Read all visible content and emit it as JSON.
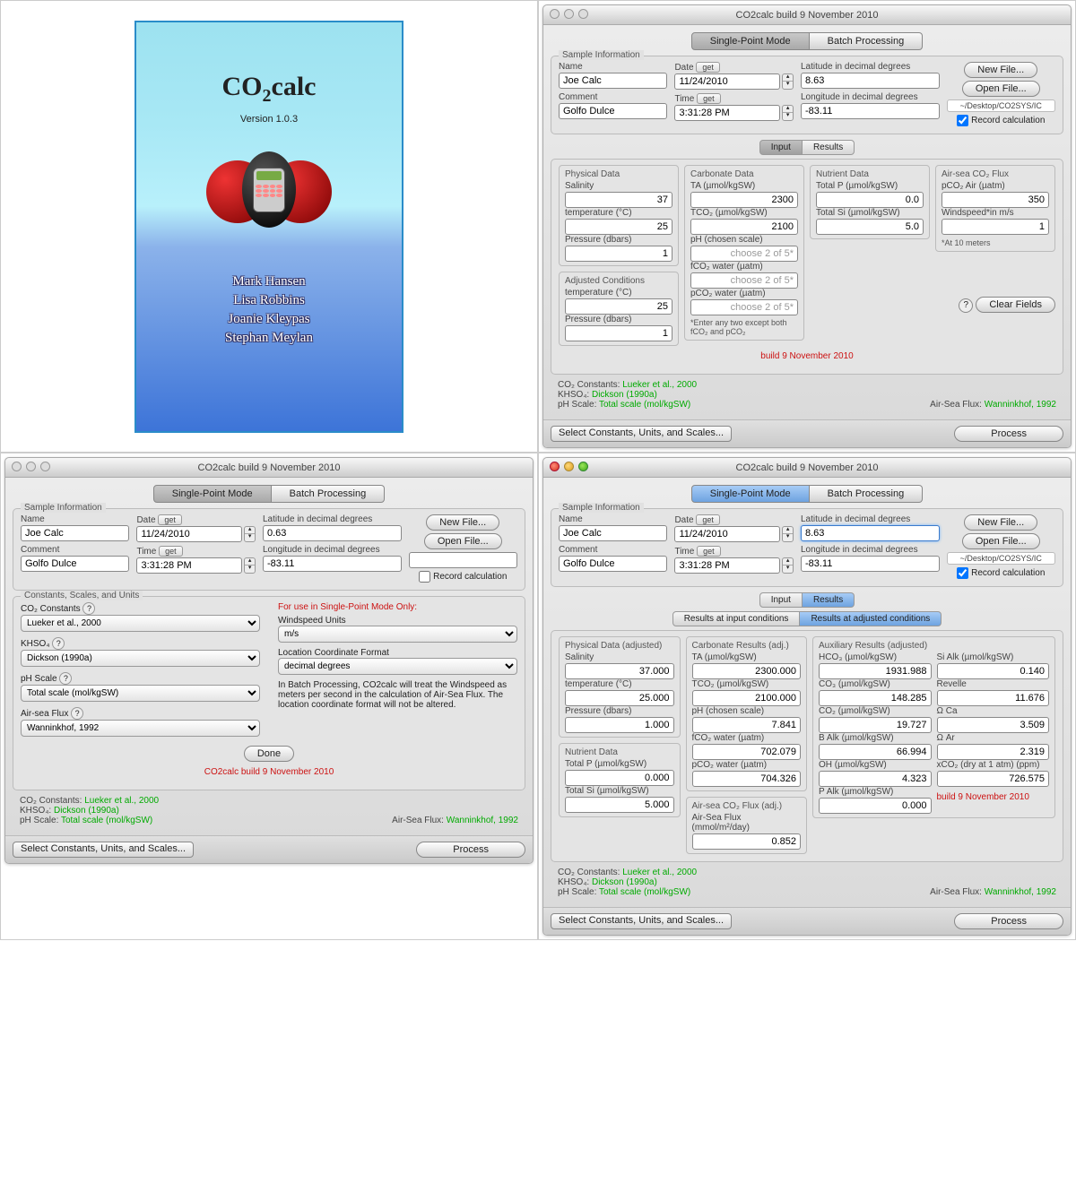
{
  "app": {
    "title": "CO2calc build 9 November 2010",
    "build_note": "build 9 November 2010",
    "build_note2": "CO2calc build 9 November 2010"
  },
  "splash": {
    "name": "CO",
    "sub": "2",
    "suffix": "calc",
    "version": "Version 1.0.3",
    "authors": [
      "Mark Hansen",
      "Lisa Robbins",
      "Joanie Kleypas",
      "Stephan Meylan"
    ]
  },
  "tabs": {
    "single": "Single-Point Mode",
    "batch": "Batch Processing",
    "input": "Input",
    "results": "Results",
    "res_input": "Results at input conditions",
    "res_adj": "Results at adjusted conditions"
  },
  "labels": {
    "sample": "Sample Information",
    "name": "Name",
    "date": "Date",
    "time": "Time",
    "comment": "Comment",
    "lat": "Latitude in decimal degrees",
    "lon": "Longitude in decimal degrees",
    "get": "get",
    "newfile": "New File...",
    "openfile": "Open File...",
    "record": "Record calculation",
    "physical": "Physical Data",
    "carbonate": "Carbonate Data",
    "nutrient": "Nutrient Data",
    "flux": "Air-sea CO₂ Flux",
    "salinity": "Salinity",
    "temp": "temperature (°C)",
    "press": "Pressure (dbars)",
    "adjusted": "Adjusted Conditions",
    "ta": "TA (µmol/kgSW)",
    "tco2": "TCO₂ (µmol/kgSW)",
    "ph": "pH (chosen scale)",
    "fco2": "fCO₂ water (µatm)",
    "pco2": "pCO₂ water (µatm)",
    "choose": "choose 2 of 5*",
    "hint": "*Enter any two except both fCO₂ and pCO₂",
    "totalp": "Total P (µmol/kgSW)",
    "totalsi": "Total Si (µmol/kgSW)",
    "pco2air": "pCO₂ Air (µatm)",
    "windspeed": "Windspeed*in m/s",
    "at10": "*At 10 meters",
    "clear": "Clear Fields",
    "select": "Select Constants, Units, and Scales...",
    "process": "Process",
    "done": "Done",
    "co2const": "CO₂ Constants:",
    "khso4": "KHSO₄:",
    "phscale": "pH Scale:",
    "airsea": "Air-Sea Flux:",
    "constants_group": "Constants, Scales, and Units",
    "co2const_l": "CO₂ Constants",
    "khso4_l": "KHSO₄",
    "phscale_l": "pH Scale",
    "airseaflux_l": "Air-sea Flux",
    "sp_note": "For use in Single-Point Mode Only:",
    "ws_units": "Windspeed Units",
    "loc_fmt": "Location Coordinate Format",
    "batch_note": "In Batch Processing, CO2calc will treat the Windspeed as meters per second in the calculation of Air-Sea Flux. The location coordinate format will not be altered.",
    "phys_adj": "Physical Data (adjusted)",
    "carb_adj": "Carbonate Results (adj.)",
    "flux_adj": "Air-sea CO₂ Flux (adj.)",
    "aux_adj": "Auxiliary Results (adjusted)",
    "nutr": "Nutrient Data",
    "hco3": "HCO₃ (µmol/kgSW)",
    "co3": "CO₃ (µmol/kgSW)",
    "co2": "CO₂ (µmol/kgSW)",
    "balk": "B Alk (µmol/kgSW)",
    "oh": "OH (µmol/kgSW)",
    "palk": "P Alk (µmol/kgSW)",
    "sialk": "Si Alk (µmol/kgSW)",
    "revelle": "Revelle",
    "omca": "Ω Ca",
    "omar": "Ω Ar",
    "xco2": "xCO₂ (dry at 1 atm) (ppm)",
    "airseaflux2": "Air-Sea Flux (mmol/m²/day)"
  },
  "vals": {
    "name": "Joe Calc",
    "date": "11/24/2010",
    "time": "3:31:28 PM",
    "comment": "Golfo Dulce",
    "lat1": "8.63",
    "lat2": "0.63",
    "lat3": "8.63",
    "lon": "-83.11",
    "path": "~/Desktop/CO2SYS/IC",
    "sal": "37",
    "temp": "25",
    "press": "1",
    "adj_temp": "25",
    "adj_press": "1",
    "ta": "2300",
    "tco2": "2100",
    "totalp": "0.0",
    "totalsi": "5.0",
    "pco2air": "350",
    "wind": "1",
    "co2const": "Lueker et al., 2000",
    "khso4": "Dickson (1990a)",
    "phscale": "Total scale (mol/kgSW)",
    "airsea": "Wanninkhof, 1992",
    "ws_unit": "m/s",
    "loc_fmt": "decimal degrees",
    "r_sal": "37.000",
    "r_temp": "25.000",
    "r_press": "1.000",
    "r_totalp": "0.000",
    "r_totalsi": "5.000",
    "r_ta": "2300.000",
    "r_tco2": "2100.000",
    "r_ph": "7.841",
    "r_fco2": "702.079",
    "r_pco2": "704.326",
    "r_asf": "0.852",
    "r_hco3": "1931.988",
    "r_co3": "148.285",
    "r_co2": "19.727",
    "r_balk": "66.994",
    "r_oh": "4.323",
    "r_palk": "0.000",
    "r_sialk": "0.140",
    "r_rev": "11.676",
    "r_omca": "3.509",
    "r_omar": "2.319",
    "r_xco2": "726.575"
  }
}
